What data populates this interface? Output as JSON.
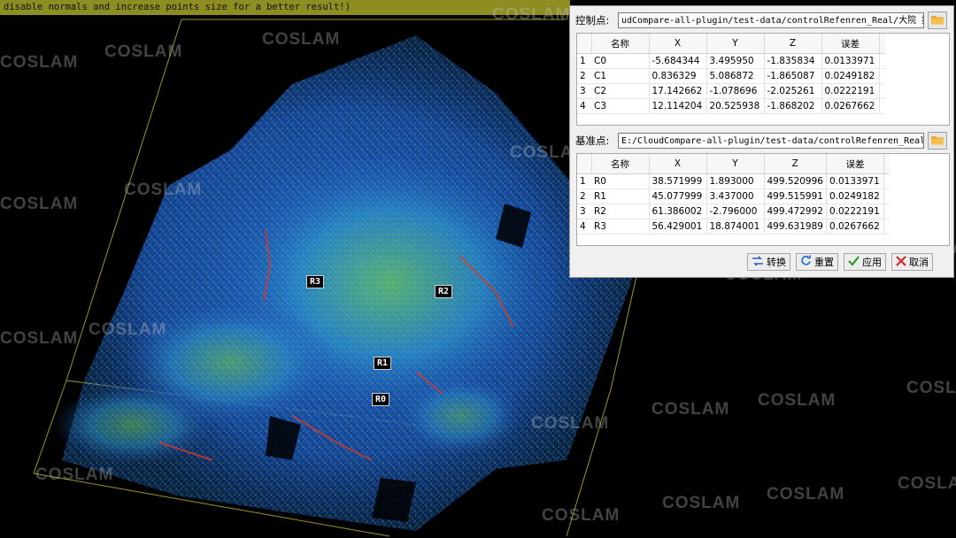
{
  "banner": {
    "text": "disable normals and increase points size for a better result!)"
  },
  "markers": [
    "R3",
    "R2",
    "R1",
    "R0"
  ],
  "watermark": "COSLAM",
  "dialog": {
    "control_label": "控制点:",
    "control_path": "udCompare-all-plugin/test-data/controlRefenren_Real/大院 控制点.csv.txt",
    "base_label": "基准点:",
    "base_path": "E:/CloudCompare-all-plugin/test-data/controlRefenren_Real/院反.txt",
    "columns": [
      "名称",
      "X",
      "Y",
      "Z",
      "误差"
    ],
    "control_rows": [
      [
        "1",
        "C0",
        "-5.684344",
        "3.495950",
        "-1.835834",
        "0.0133971"
      ],
      [
        "2",
        "C1",
        "0.836329",
        "5.086872",
        "-1.865087",
        "0.0249182"
      ],
      [
        "3",
        "C2",
        "17.142662",
        "-1.078696",
        "-2.025261",
        "0.0222191"
      ],
      [
        "4",
        "C3",
        "12.114204",
        "20.525938",
        "-1.868202",
        "0.0267662"
      ]
    ],
    "base_rows": [
      [
        "1",
        "R0",
        "38.571999",
        "1.893000",
        "499.520996",
        "0.0133971"
      ],
      [
        "2",
        "R1",
        "45.077999",
        "3.437000",
        "499.515991",
        "0.0249182"
      ],
      [
        "3",
        "R2",
        "61.386002",
        "-2.796000",
        "499.472992",
        "0.0222191"
      ],
      [
        "4",
        "R3",
        "56.429001",
        "18.874001",
        "499.631989",
        "0.0267662"
      ]
    ],
    "buttons": {
      "convert": "转换",
      "reset": "重置",
      "apply": "应用",
      "cancel": "取消"
    }
  },
  "colors": {
    "banner_bg": "#8d8d21",
    "bbox": "#b7b02a",
    "cloud_blue": "#1f63c8",
    "cloud_cyan": "#27b9c9",
    "cloud_green": "#6ed04a",
    "cloud_red": "#d63a2a"
  }
}
